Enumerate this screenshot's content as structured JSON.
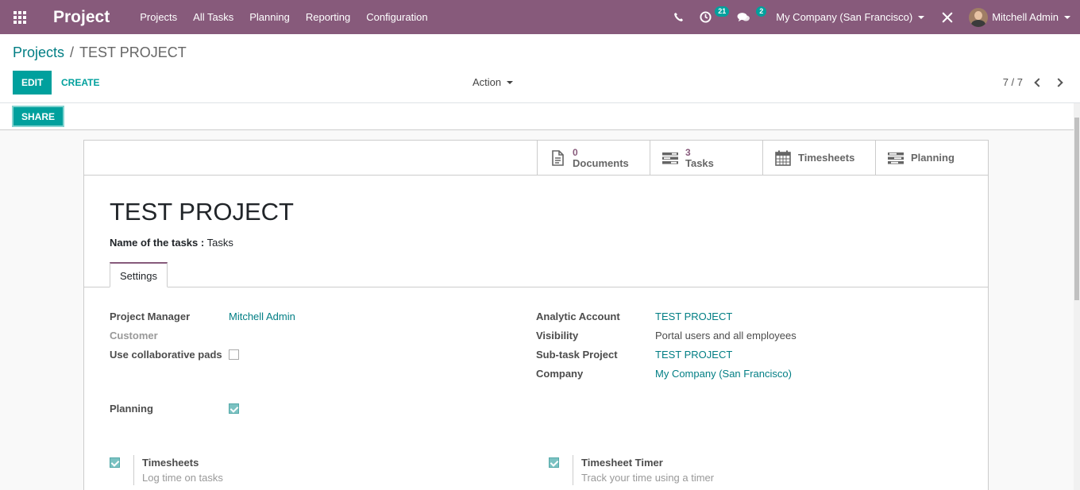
{
  "navbar": {
    "app_name": "Project",
    "menu": [
      "Projects",
      "All Tasks",
      "Planning",
      "Reporting",
      "Configuration"
    ],
    "activity_count": "21",
    "messages_count": "2",
    "company": "My Company (San Francisco)",
    "user": "Mitchell Admin",
    "accent_color": "#875a7b"
  },
  "breadcrumb": {
    "parent": "Projects",
    "separator": "/",
    "current": "TEST PROJECT"
  },
  "toolbar": {
    "edit_label": "EDIT",
    "create_label": "CREATE",
    "action_label": "Action",
    "pager": "7 / 7"
  },
  "statusbar": {
    "share_label": "SHARE"
  },
  "smart_buttons": {
    "documents": {
      "value": "0",
      "label": "Documents"
    },
    "tasks": {
      "value": "3",
      "label": "Tasks"
    },
    "timesheets": {
      "label": "Timesheets"
    },
    "planning": {
      "label": "Planning"
    }
  },
  "form": {
    "title": "TEST PROJECT",
    "tasks_name_label": "Name of the tasks :",
    "tasks_name_value": "Tasks",
    "tab_label": "Settings",
    "left_fields": {
      "project_manager_label": "Project Manager",
      "project_manager_value": "Mitchell Admin",
      "customer_label": "Customer",
      "collab_pads_label": "Use collaborative pads",
      "collab_pads_checked": false,
      "planning_label": "Planning",
      "planning_checked": true
    },
    "right_fields": {
      "analytic_account_label": "Analytic Account",
      "analytic_account_value": "TEST PROJECT",
      "visibility_label": "Visibility",
      "visibility_value": "Portal users and all employees",
      "subtask_project_label": "Sub-task Project",
      "subtask_project_value": "TEST PROJECT",
      "company_label": "Company",
      "company_value": "My Company (San Francisco)"
    },
    "settings": {
      "timesheets_title": "Timesheets",
      "timesheets_desc": "Log time on tasks",
      "timesheets_checked": true,
      "timer_title": "Timesheet Timer",
      "timer_desc": "Track your time using a timer",
      "timer_checked": true
    }
  }
}
